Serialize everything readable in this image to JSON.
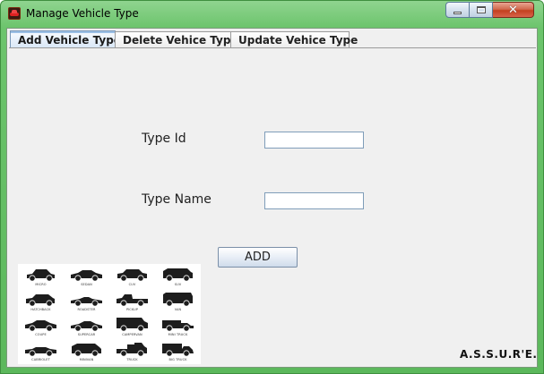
{
  "window": {
    "title": "Manage Vehicle Type",
    "icon": "car-app-icon",
    "controls": [
      "minimize-icon",
      "maximize-icon",
      "close-icon"
    ]
  },
  "tabs": [
    {
      "label": "Add Vehicle Type",
      "selected": true
    },
    {
      "label": "Delete Vehice Type",
      "selected": false
    },
    {
      "label": "Update Vehice Type",
      "selected": false
    }
  ],
  "form": {
    "type_id_label": "Type Id",
    "type_id_value": "",
    "type_name_label": "Type Name",
    "type_name_value": "",
    "add_button_label": "ADD"
  },
  "vehicles": [
    "MICRO",
    "SEDAN",
    "CUV",
    "SUV",
    "HATCHBACK",
    "ROADSTER",
    "PICKUP",
    "VAN",
    "COUPE",
    "SUPERCAR",
    "CAMPERVAN",
    "MINI TRUCK",
    "CABRIOLET",
    "MINIVAN",
    "TRUCK",
    "BIG TRUCK"
  ],
  "brand": "A.S.S.U.R'E.",
  "colors": {
    "titlebar": "#6cc46c",
    "panel_background": "#f0f0f0",
    "selected_tab": "#d8e6f6",
    "close_button": "#c3401f"
  }
}
